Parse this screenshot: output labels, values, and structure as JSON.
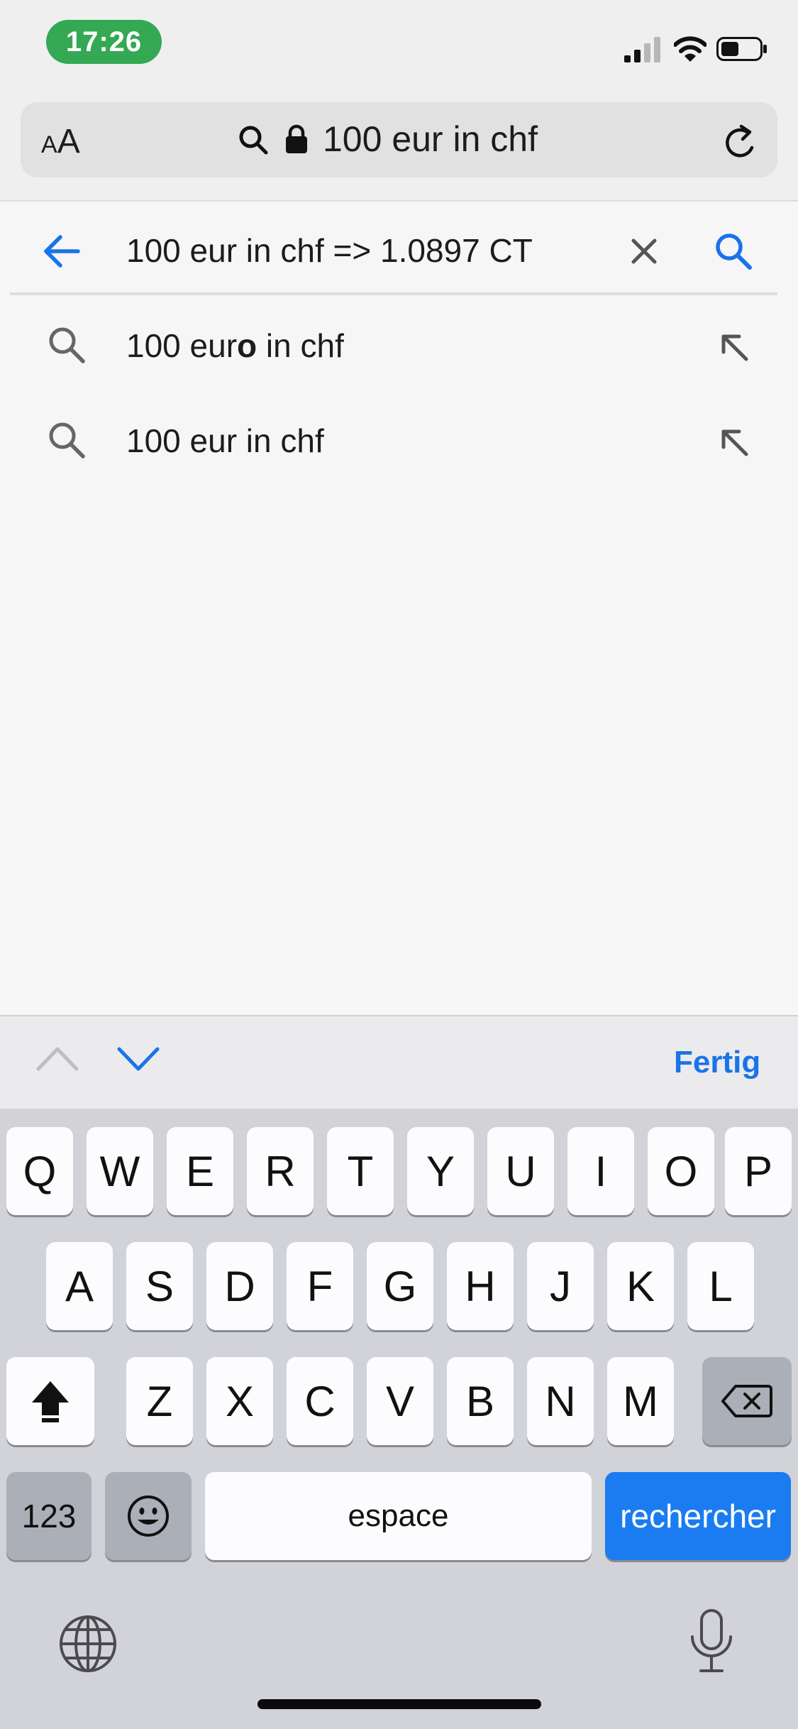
{
  "status_bar": {
    "time": "17:26"
  },
  "address_bar": {
    "aa_label_small": "A",
    "aa_label_large": "A",
    "url_text": "100 eur in chf"
  },
  "search": {
    "query": "100 eur in chf => 1.0897 CT"
  },
  "suggestions": [
    {
      "prefix": "100 eur",
      "bold": "o",
      "suffix": " in chf"
    },
    {
      "prefix": "100 eur in chf",
      "bold": "",
      "suffix": ""
    }
  ],
  "accessory_bar": {
    "done_label": "Fertig"
  },
  "keyboard": {
    "row1": [
      "Q",
      "W",
      "E",
      "R",
      "T",
      "Y",
      "U",
      "I",
      "O",
      "P"
    ],
    "row2": [
      "A",
      "S",
      "D",
      "F",
      "G",
      "H",
      "J",
      "K",
      "L"
    ],
    "row3": [
      "Z",
      "X",
      "C",
      "V",
      "B",
      "N",
      "M"
    ],
    "numbers_label": "123",
    "space_label": "espace",
    "return_label": "rechercher"
  },
  "colors": {
    "accent": "#1a73e8",
    "time_pill": "#34a853",
    "return_key": "#1a7cf0"
  },
  "icons": [
    "signal-icon",
    "wifi-icon",
    "battery-icon",
    "search-icon",
    "lock-icon",
    "reload-icon",
    "back-arrow-icon",
    "clear-icon",
    "fill-arrow-icon",
    "chevron-up-icon",
    "chevron-down-icon",
    "shift-icon",
    "delete-icon",
    "emoji-icon",
    "globe-icon",
    "microphone-icon"
  ]
}
